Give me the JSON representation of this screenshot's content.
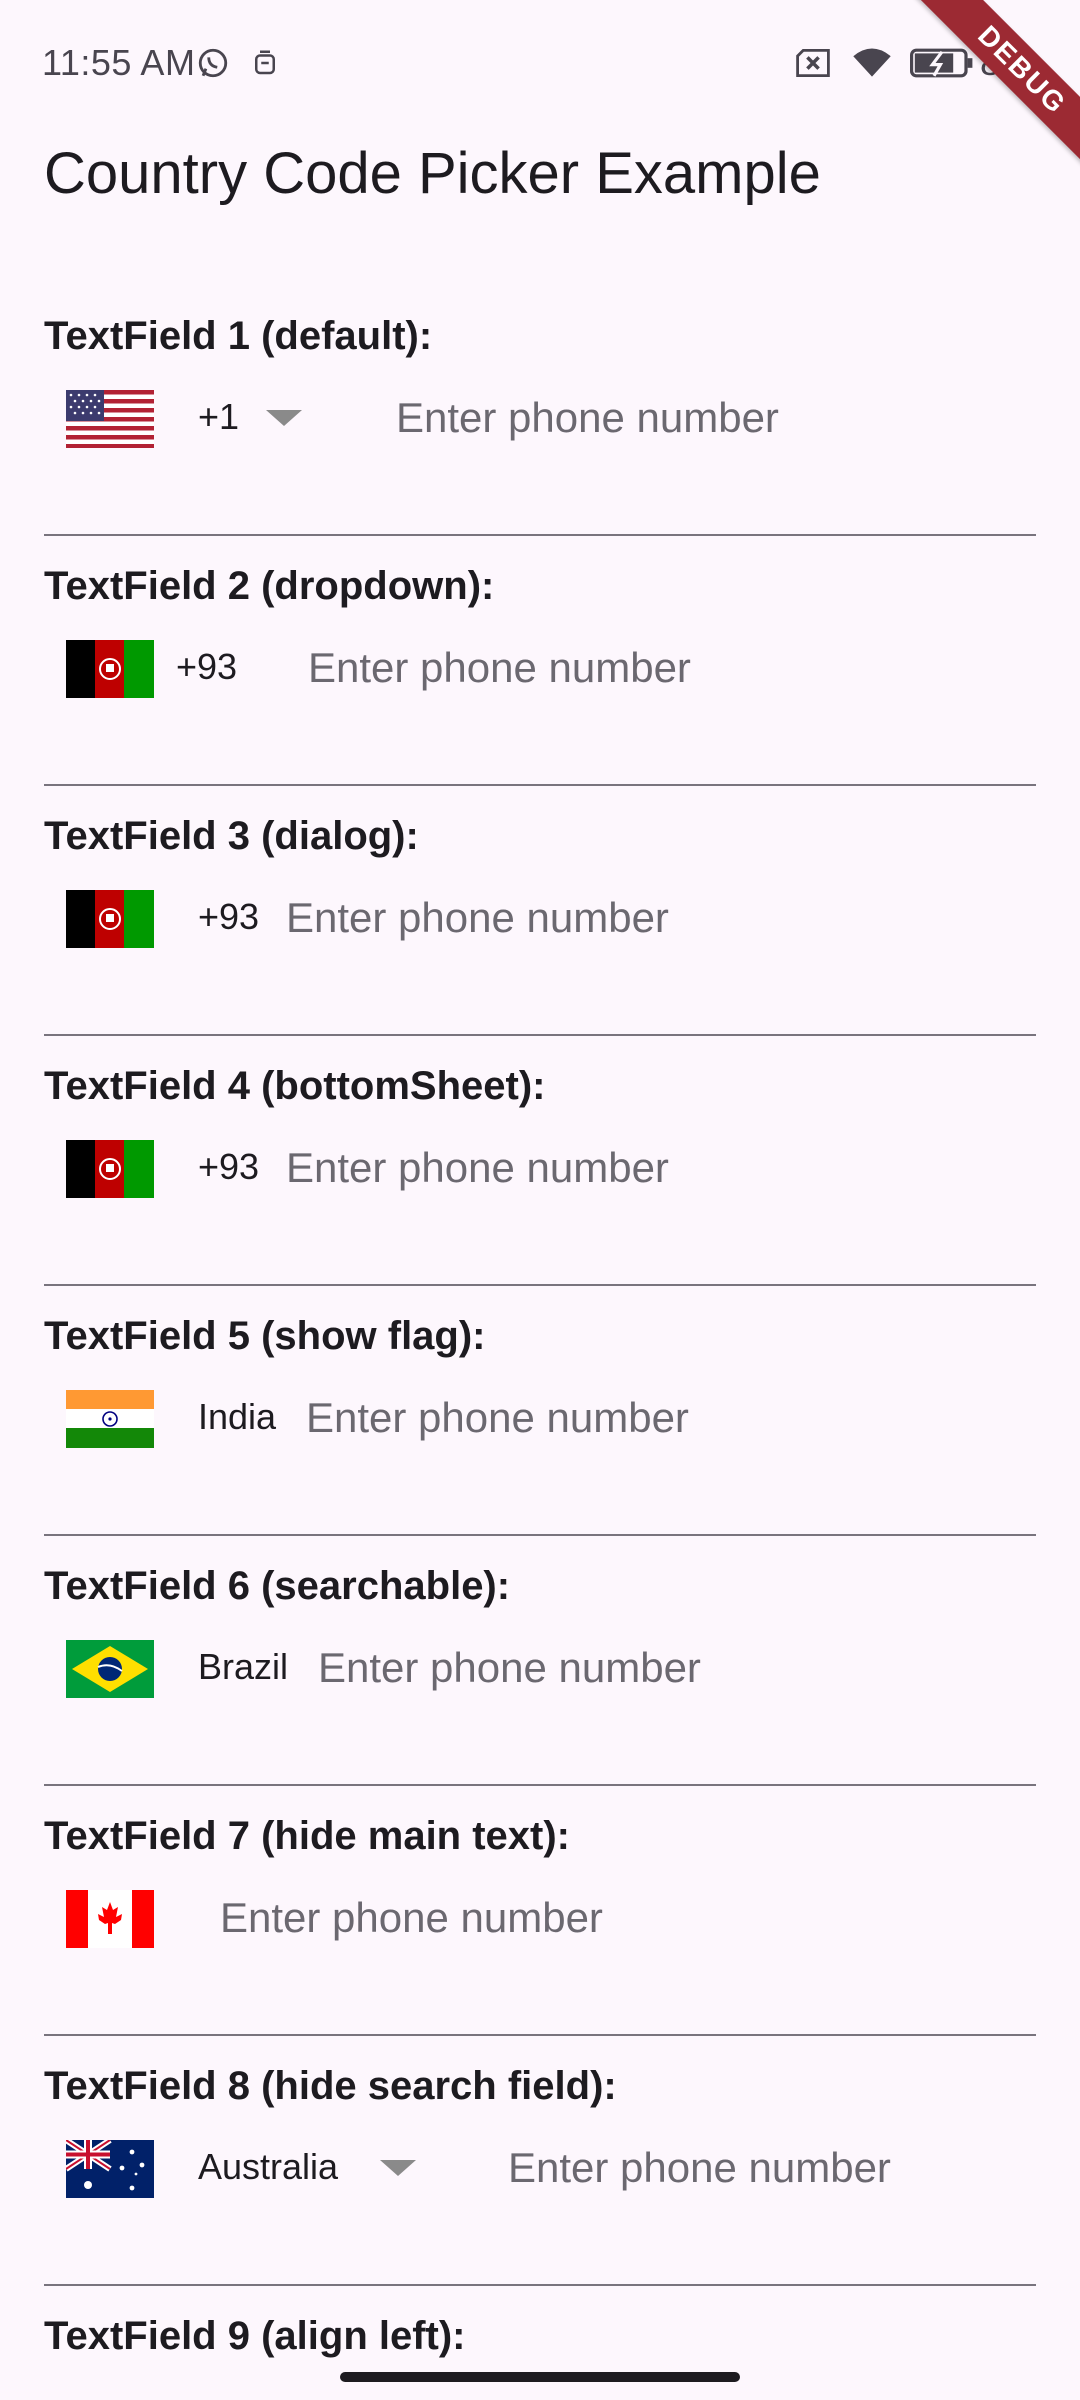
{
  "status_bar": {
    "time": "11:55 AM",
    "battery_text": "85",
    "icons": [
      "whatsapp-icon",
      "notification-icon",
      "no-sim-icon",
      "wifi-icon",
      "battery-charging-icon"
    ]
  },
  "debug_banner": "DEBUG",
  "app": {
    "title": "Country Code Picker Example"
  },
  "fields": [
    {
      "label": "TextField 1 (default):",
      "country_text": "+1",
      "flag": "us-flag",
      "placeholder": "Enter phone number",
      "has_caret": true
    },
    {
      "label": "TextField 2 (dropdown):",
      "country_text": "+93",
      "flag": "afghanistan-flag",
      "placeholder": "Enter phone number",
      "has_caret": false
    },
    {
      "label": "TextField 3 (dialog):",
      "country_text": "+93",
      "flag": "afghanistan-flag",
      "placeholder": "Enter phone number",
      "has_caret": false
    },
    {
      "label": "TextField 4 (bottomSheet):",
      "country_text": "+93",
      "flag": "afghanistan-flag",
      "placeholder": "Enter phone number",
      "has_caret": false
    },
    {
      "label": "TextField 5 (show flag):",
      "country_text": "India",
      "flag": "india-flag",
      "placeholder": "Enter phone number",
      "has_caret": false
    },
    {
      "label": "TextField 6 (searchable):",
      "country_text": "Brazil",
      "flag": "brazil-flag",
      "placeholder": "Enter phone number",
      "has_caret": false
    },
    {
      "label": "TextField 7 (hide main text):",
      "country_text": "",
      "flag": "canada-flag",
      "placeholder": "Enter phone number",
      "has_caret": false
    },
    {
      "label": "TextField 8 (hide search field):",
      "country_text": "Australia",
      "flag": "australia-flag",
      "placeholder": "Enter phone number",
      "has_caret": true
    },
    {
      "label": "TextField 9 (align left):"
    }
  ],
  "colors": {
    "background": "#fdf7fd",
    "text": "#1d1b20",
    "placeholder": "#6b6870",
    "underline": "#79747e",
    "debug_ribbon": "#9c2a33"
  }
}
